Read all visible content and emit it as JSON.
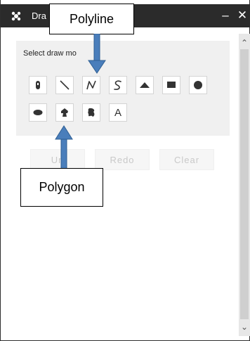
{
  "window": {
    "title": "Dra",
    "icon": "draw-tool-icon",
    "minimize_glyph": "–",
    "close_glyph": "✕"
  },
  "panel": {
    "label": "Select draw mo",
    "tools": [
      {
        "name": "point",
        "icon": "marker-icon"
      },
      {
        "name": "line",
        "icon": "line-icon"
      },
      {
        "name": "polyline",
        "icon": "polyline-icon"
      },
      {
        "name": "freehand-polyline",
        "icon": "freehand-line-icon"
      },
      {
        "name": "triangle",
        "icon": "triangle-icon"
      },
      {
        "name": "rectangle",
        "icon": "rectangle-icon"
      },
      {
        "name": "circle",
        "icon": "circle-icon"
      },
      {
        "name": "ellipse",
        "icon": "ellipse-icon"
      },
      {
        "name": "polygon",
        "icon": "polygon-icon"
      },
      {
        "name": "freehand-polygon",
        "icon": "freehand-polygon-icon"
      },
      {
        "name": "text",
        "icon": "text-icon",
        "label": "A"
      }
    ]
  },
  "actions": {
    "undo": "Un",
    "redo": "Redo",
    "clear": "Clear"
  },
  "annotations": {
    "polyline": "Polyline",
    "polygon": "Polygon",
    "arrow_color": "#4a7ebb"
  },
  "scrollbar": {
    "up_glyph": "⌃",
    "down_glyph": "⌄"
  }
}
